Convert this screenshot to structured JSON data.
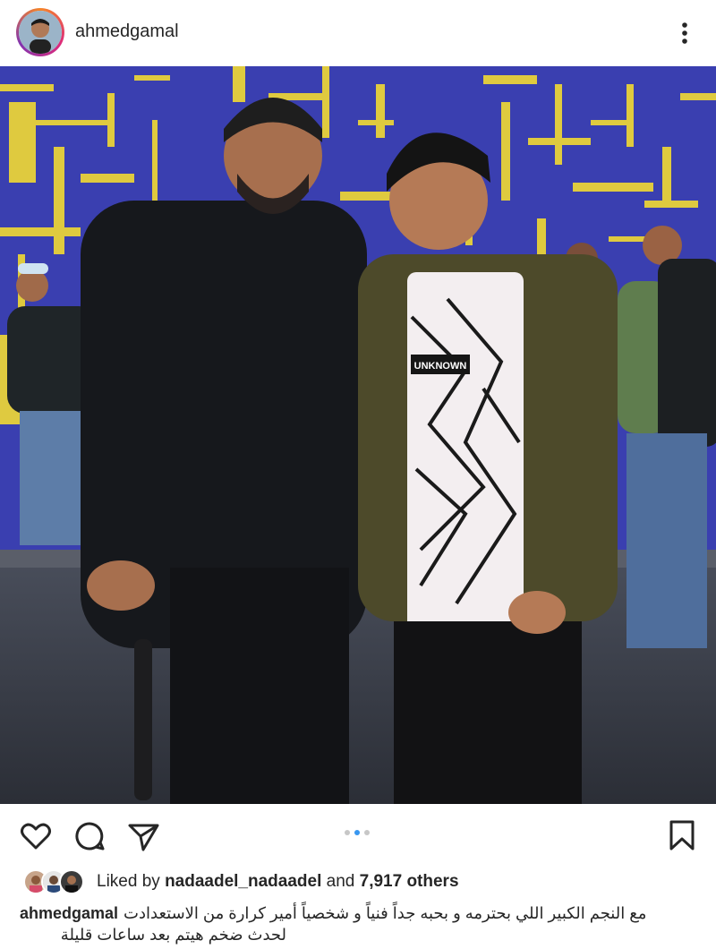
{
  "post": {
    "username": "ahmedgamal",
    "photo_alt": "Two men posing together in front of a blue and yellow backdrop at night",
    "shirt_text": "UNKNOWN"
  },
  "icons": {
    "more": "more-vertical-icon",
    "like": "heart-icon",
    "comment": "comment-icon",
    "share": "send-icon",
    "save": "bookmark-icon"
  },
  "carousel": {
    "count": 3,
    "active": 2
  },
  "likes": {
    "prefix": "Liked by",
    "user": "nadaadel_nadaadel",
    "joiner": "and",
    "others": "7,917 others"
  },
  "caption": {
    "username": "ahmedgamal",
    "line1": "مع النجم الكبير اللي بحترمه و بحبه جداً فنياً و شخصياً أمير كرارة من الاستعدادت",
    "line2": "لحدث ضخم هيتم بعد ساعات قليلة"
  },
  "colors": {
    "backdrop_blue": "#3a3fb0",
    "backdrop_yellow": "#e8d23a",
    "text": "#262626",
    "active_dot": "#3897f0"
  }
}
